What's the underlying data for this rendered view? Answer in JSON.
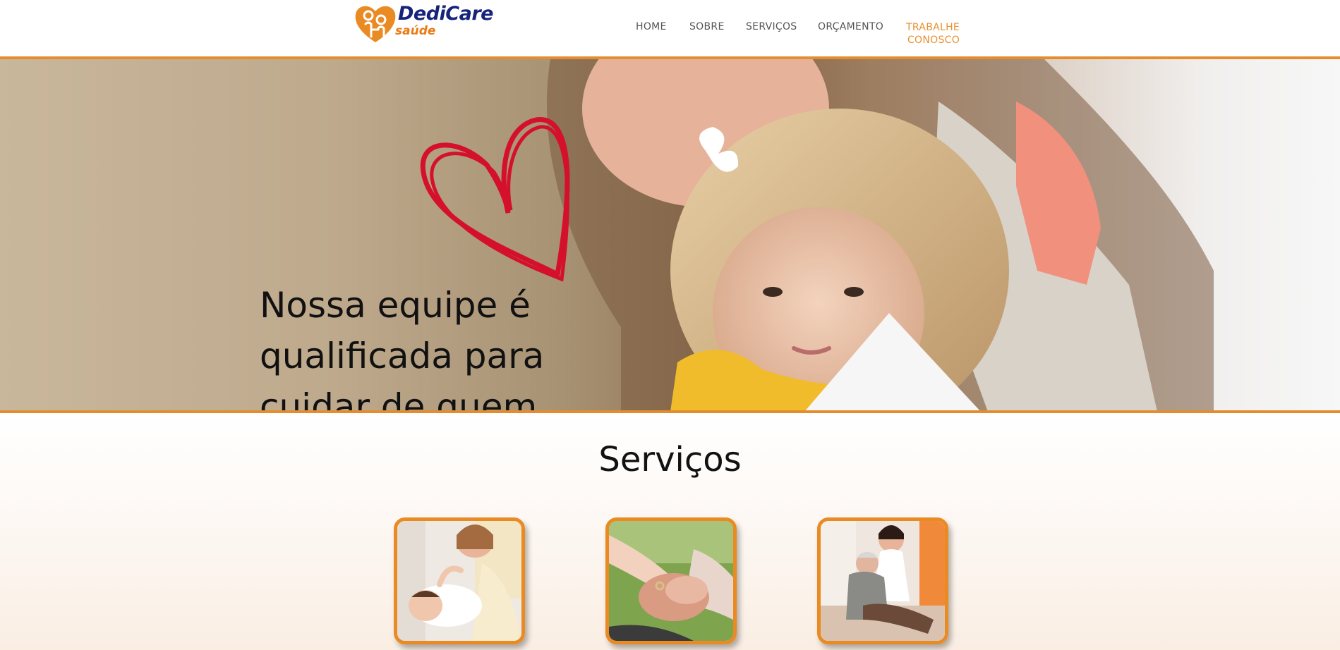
{
  "brand": {
    "name": "DediCare",
    "sub": "saúde"
  },
  "nav": {
    "items": [
      "HOME",
      "SOBRE",
      "SERVIÇOS",
      "ORÇAMENTO"
    ],
    "active_line1": "TRABALHE",
    "active_line2": "CONOSCO"
  },
  "hero": {
    "text_line1": "Nossa equipe é",
    "text_line2": "qualificada para",
    "text_line3": "cuidar de quem"
  },
  "services": {
    "title": "Serviços"
  },
  "colors": {
    "accent": "#e48d2f",
    "brand_blue": "#16237a",
    "heart": "#d4102a"
  },
  "icons": [
    "logo-heart-icon",
    "hero-heart-icon"
  ]
}
